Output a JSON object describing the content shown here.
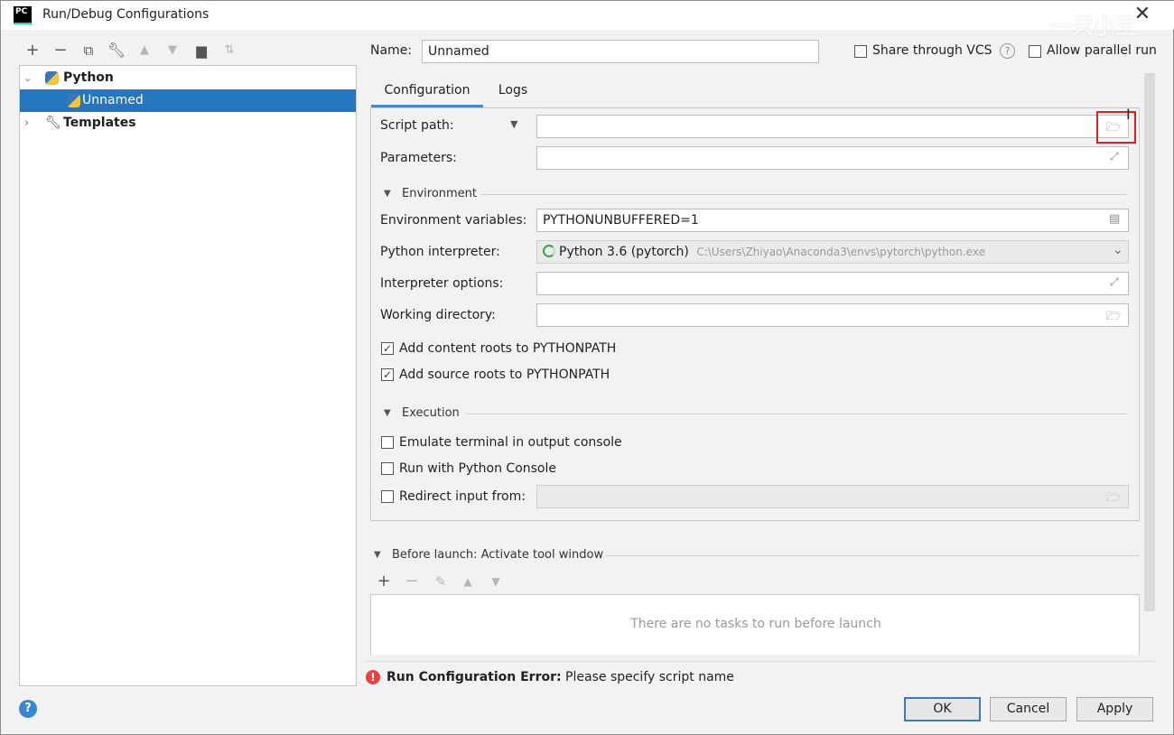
{
  "window": {
    "title": "Run/Debug Configurations",
    "app_logo": "PC",
    "watermark": "一只小王",
    "close": "✕"
  },
  "toolbar": {
    "icons": [
      "add-icon",
      "remove-icon",
      "copy-icon",
      "edit-defaults-icon",
      "move-up-icon",
      "move-down-icon",
      "new-folder-icon",
      "sort-icon"
    ]
  },
  "tree": {
    "items": [
      {
        "label": "Python",
        "icon": "python-icon",
        "expanded": true
      },
      {
        "label": "Unnamed",
        "icon": "python-config-icon",
        "selected": true
      },
      {
        "label": "Templates",
        "icon": "wrench-icon",
        "expanded": false
      }
    ]
  },
  "header": {
    "name_label": "Name:",
    "name_value": "Unnamed",
    "share_vcs": "Share through VCS",
    "allow_parallel": "Allow parallel run"
  },
  "tabs": [
    {
      "label": "Configuration",
      "active": true
    },
    {
      "label": "Logs",
      "active": false
    }
  ],
  "config": {
    "script_path_label": "Script path:",
    "script_path_value": "",
    "parameters_label": "Parameters:",
    "parameters_value": "",
    "environment_title": "Environment",
    "env_vars_label": "Environment variables:",
    "env_vars_value": "PYTHONUNBUFFERED=1",
    "interpreter_label": "Python interpreter:",
    "interpreter_name": "Python 3.6 (pytorch)",
    "interpreter_path": "C:\\Users\\Zhiyao\\Anaconda3\\envs\\pytorch\\python.exe",
    "interp_options_label": "Interpreter options:",
    "working_dir_label": "Working directory:",
    "add_content_roots": "Add content roots to PYTHONPATH",
    "add_source_roots": "Add source roots to PYTHONPATH",
    "execution_title": "Execution",
    "emulate_terminal": "Emulate terminal in output console",
    "run_with_console": "Run with Python Console",
    "redirect_input": "Redirect input from:"
  },
  "before_launch": {
    "title": "Before launch: Activate tool window",
    "empty_text": "There are no tasks to run before launch"
  },
  "error": {
    "bold": "Run Configuration Error:",
    "message": " Please specify script name"
  },
  "buttons": {
    "ok": "OK",
    "cancel": "Cancel",
    "apply": "Apply",
    "help": "?"
  },
  "colors": {
    "selection": "#2675bf",
    "highlight_box": "#e02020",
    "tab_underline": "#4a88c7",
    "error": "#e4443f"
  }
}
